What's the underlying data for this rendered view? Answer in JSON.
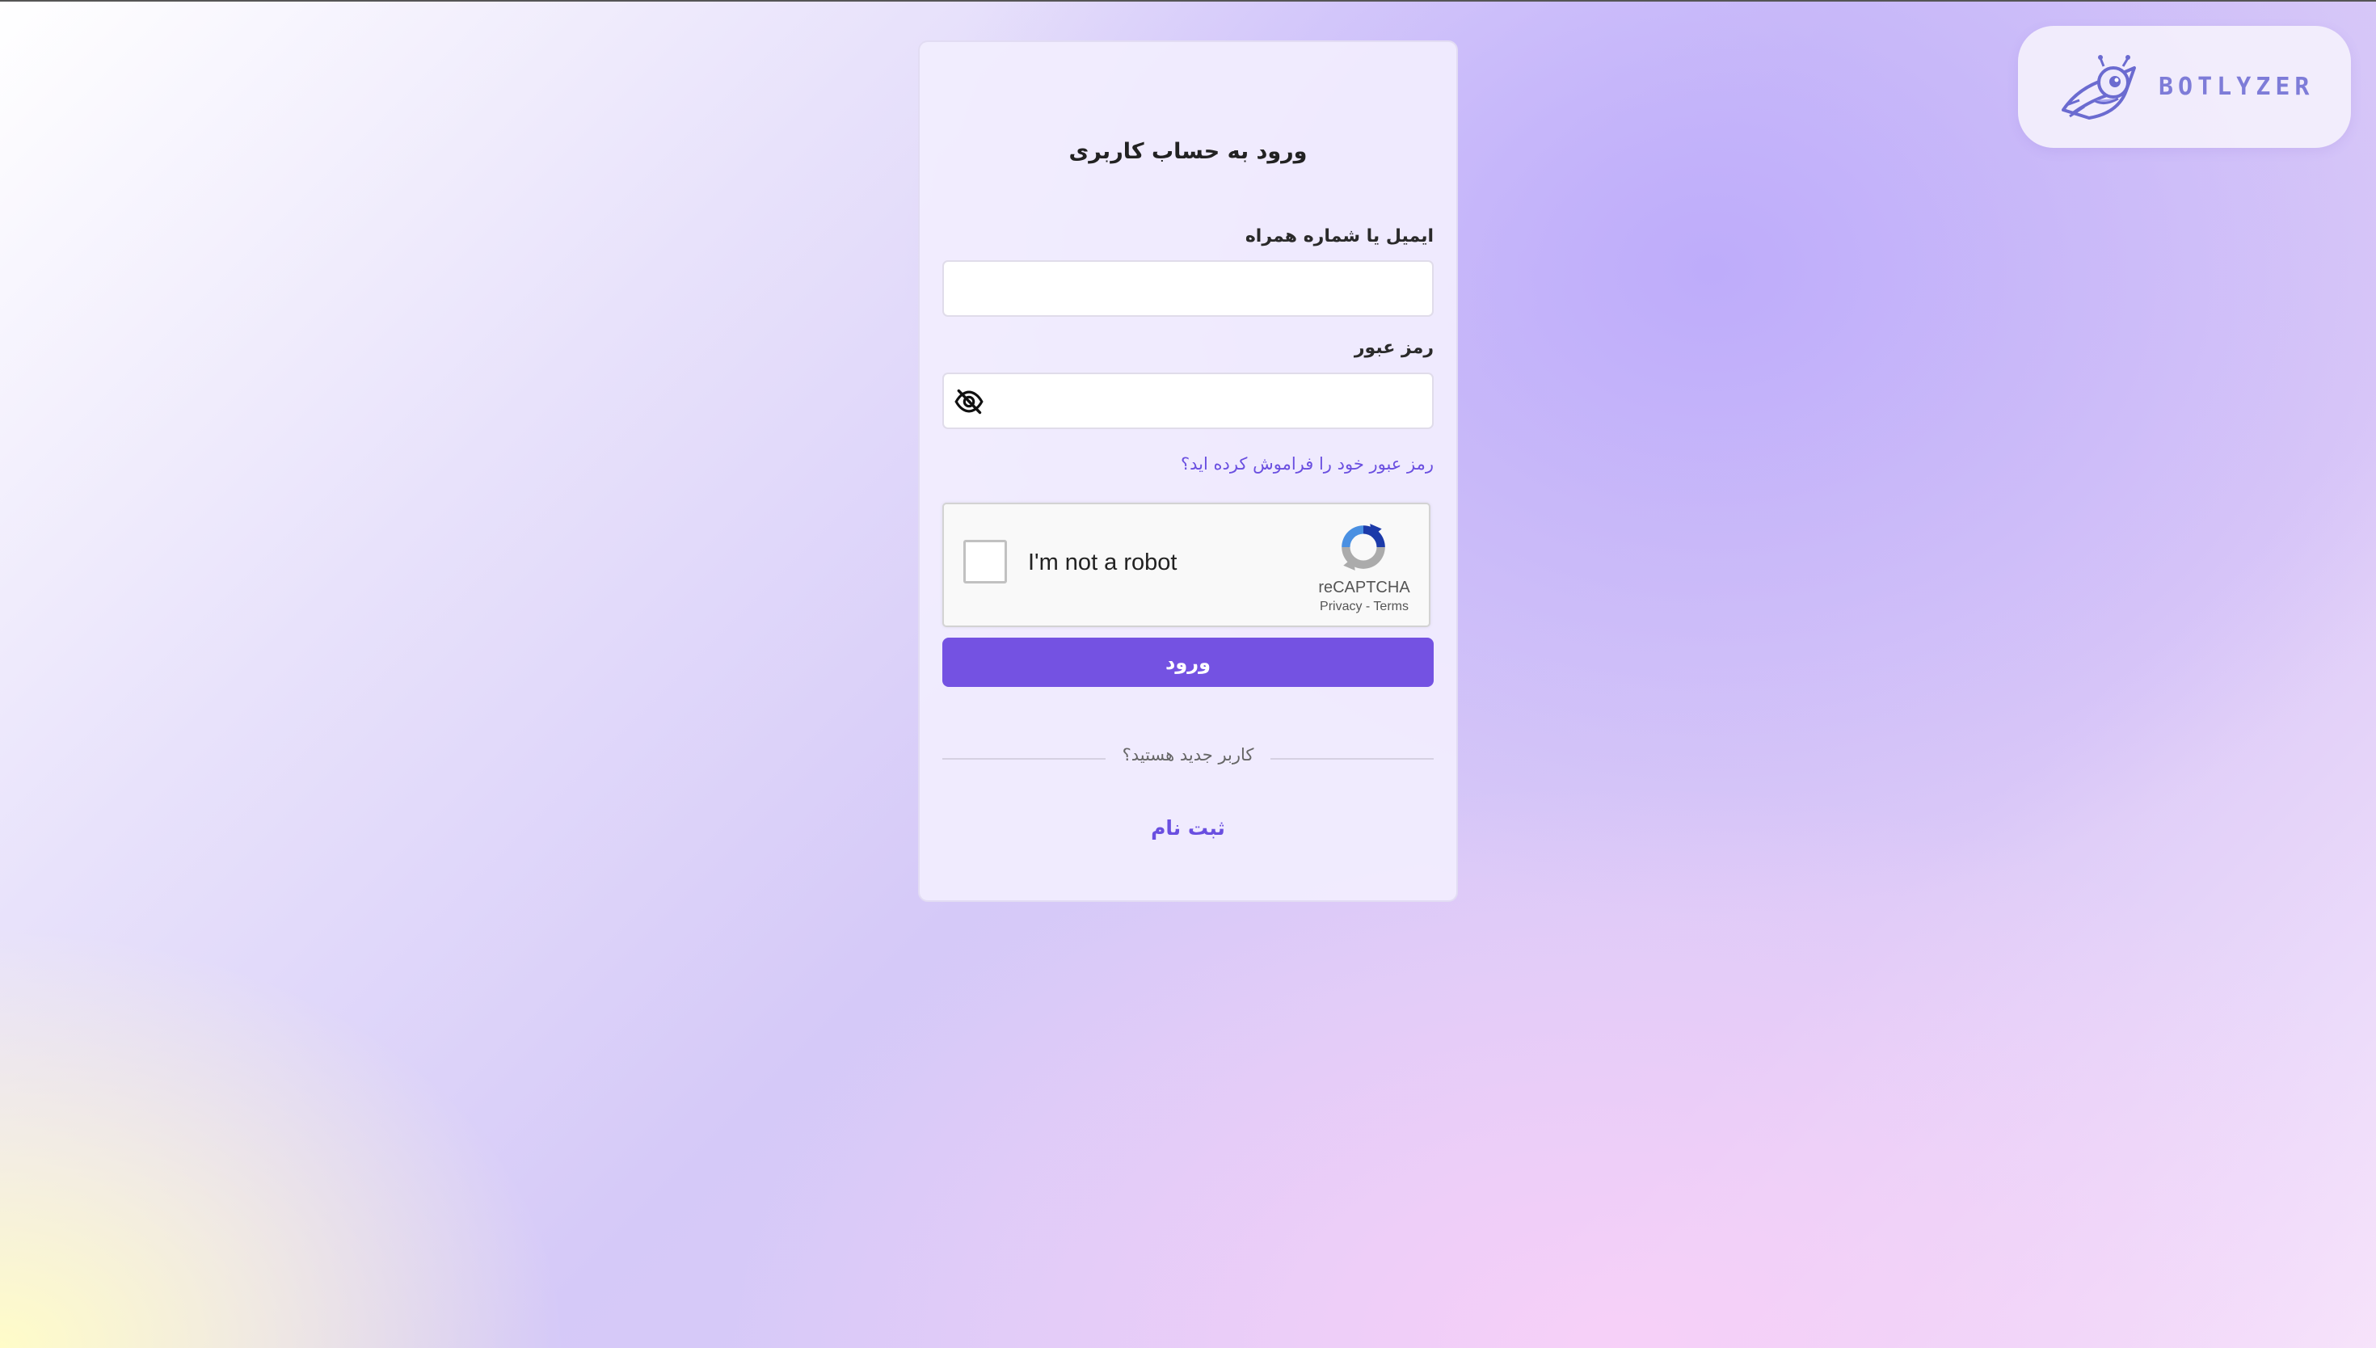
{
  "brand": {
    "logo_text": "BOTLYZER",
    "mascot_icon": "robot-rocket-icon",
    "color": "#7e7cd8"
  },
  "login_form": {
    "title": "ورود به حساب کاربری",
    "email_label": "ایمیل یا شماره همراه",
    "email_value": "",
    "password_label": "رمز عبور",
    "password_value": "",
    "password_toggle_icon": "eye-off-icon",
    "forgot_password_link": "رمز عبور خود را فراموش کرده اید؟",
    "submit_label": "ورود",
    "new_user_prompt": "کاربر جدید هستید؟",
    "register_link": "ثبت نام",
    "accent_color": "#7452e2"
  },
  "captcha": {
    "checkbox_label": "I'm not a robot",
    "checked": false,
    "brand": "reCAPTCHA",
    "links": "Privacy - Terms"
  }
}
